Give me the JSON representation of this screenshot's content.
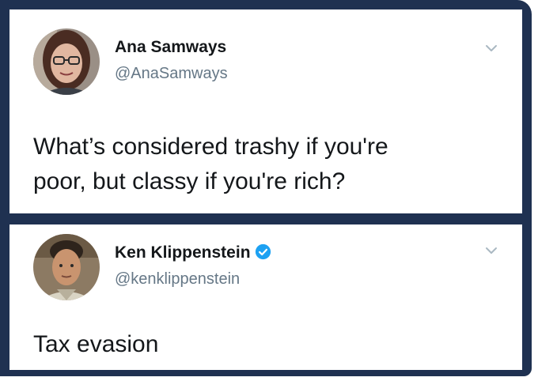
{
  "tweets": [
    {
      "name": "Ana Samways",
      "handle": "@AnaSamways",
      "text_lines": [
        "What’s considered trashy if you're",
        "poor, but classy if you're rich?"
      ],
      "verified": false,
      "avatar_icon": "avatar-woman-glasses"
    },
    {
      "name": "Ken Klippenstein",
      "handle": "@kenklippenstein",
      "text_lines": [
        "Tax evasion"
      ],
      "verified": true,
      "avatar_icon": "avatar-man"
    }
  ],
  "colors": {
    "frame": "#1f3151",
    "name": "#14171a",
    "handle": "#657786",
    "verified": "#1da1f2"
  }
}
